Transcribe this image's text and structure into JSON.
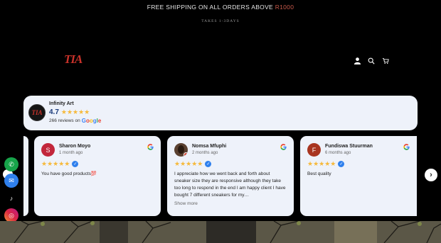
{
  "announcement": {
    "text": "FREE SHIPPING ON ALL ORDERS ABOVE ",
    "amount": "R1000",
    "subline": "TAKES 1-3DAYS"
  },
  "header": {
    "logo_text": "TIA",
    "icons": [
      "account-icon",
      "search-icon",
      "cart-icon"
    ]
  },
  "reviews_widget": {
    "business_name": "Infinity Art",
    "logo_text": "TIA",
    "rating": "4.7",
    "stars": "★★★★★",
    "review_count": "266 reviews on",
    "google_word": [
      "G",
      "o",
      "o",
      "g",
      "l",
      "e"
    ],
    "reviews": [
      {
        "initial": "S",
        "name": "Sharon Moyo",
        "date": "1 month ago",
        "stars": "★★★★★",
        "text": "You have good products",
        "text_faded": "💯"
      },
      {
        "initial": "",
        "name": "Nomsa Mfuphi",
        "date": "2 months ago",
        "stars": "★★★★★",
        "text": "I appreciate how we went back and forth about sneaker size they are responsive although they take too long to respond in the end I am happy client I have bought 7 different sneakers for my…",
        "show_more": "Show more"
      },
      {
        "initial": "F",
        "name": "Fundiswa Stuurman",
        "date": "6 months ago",
        "stars": "★★★★★",
        "text": "Best quality"
      }
    ],
    "next_arrow": "›"
  },
  "floating_contacts": {
    "phone": "✆",
    "mail": "✉",
    "tiktok": "♪",
    "instagram": "◎"
  },
  "colors": {
    "accent_red": "#c8322a",
    "card_bg": "#eef2fa",
    "star": "#f6b93b",
    "verified": "#2f80ed"
  }
}
